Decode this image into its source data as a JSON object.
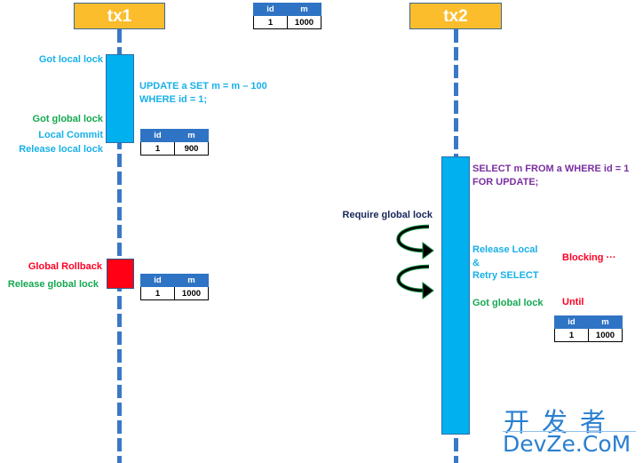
{
  "participants": {
    "tx1": "tx1",
    "tx2": "tx2"
  },
  "tables": {
    "header": {
      "id": "id",
      "m": "m"
    },
    "initial": {
      "id": "1",
      "m": "1000"
    },
    "after_commit": {
      "id": "1",
      "m": "900"
    },
    "after_rollback": {
      "id": "1",
      "m": "1000"
    },
    "tx2_result": {
      "id": "1",
      "m": "1000"
    }
  },
  "tx1": {
    "got_local_lock": "Got local lock",
    "sql_line1": "UPDATE a SET m = m – 100",
    "sql_line2": "WHERE id = 1;",
    "got_global_lock": "Got global lock",
    "local_commit": "Local Commit",
    "release_local_lock": "Release local lock",
    "global_rollback": "Global Rollback",
    "release_global_lock": "Release global lock"
  },
  "tx2": {
    "sql_line1": "SELECT m FROM a WHERE id = 1",
    "sql_line2": "FOR UPDATE;",
    "require_global_lock": "Require global lock",
    "release_local": "Release Local",
    "ampersand": "&",
    "retry_select": "Retry SELECT",
    "got_global_lock": "Got global lock",
    "blocking": "Blocking ···",
    "until": "Until"
  },
  "watermark": {
    "cn": "开发者",
    "en": "DevZe.CoM"
  },
  "colors": {
    "tx_header": "#fbbd2c",
    "activation": "#00b0ef",
    "rollback": "#ff0014",
    "lifeline": "#3a78c6"
  }
}
